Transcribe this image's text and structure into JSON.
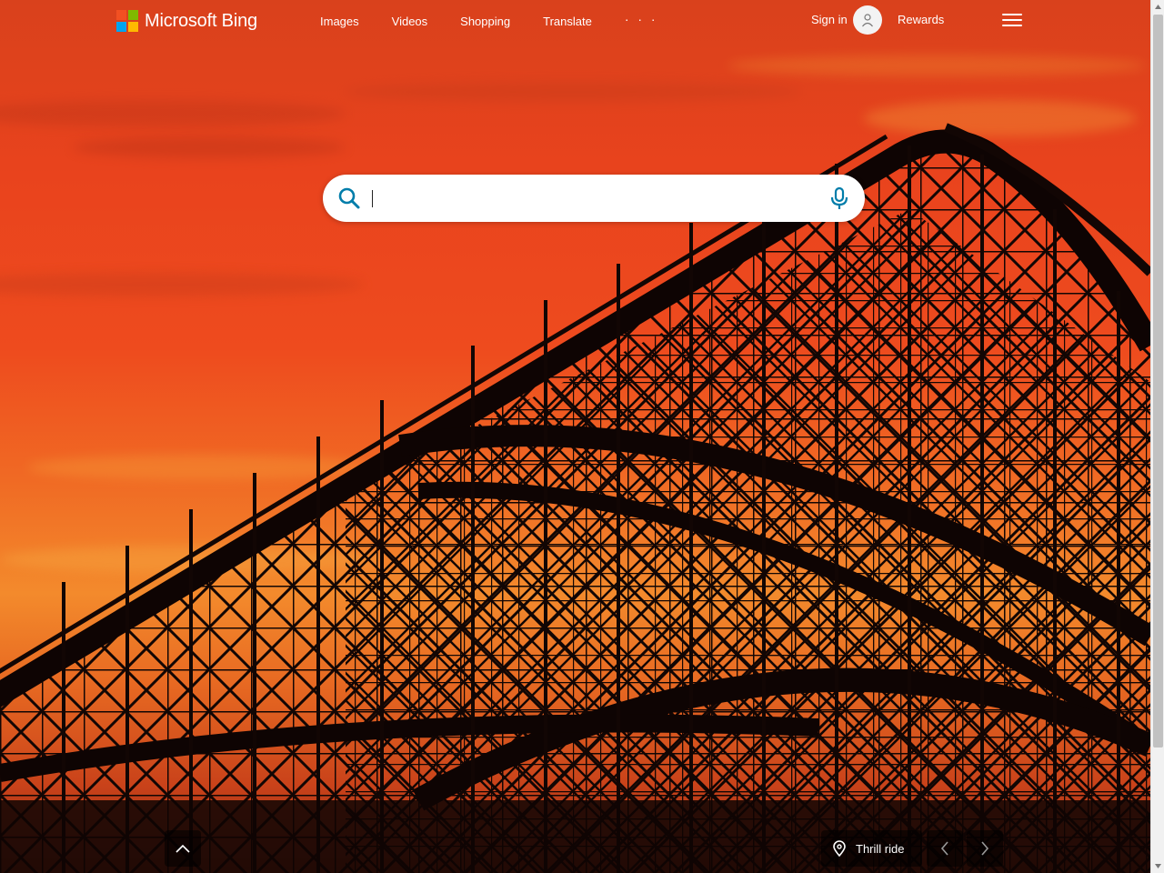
{
  "header": {
    "logo_text": "Microsoft Bing",
    "nav": [
      {
        "label": "Images"
      },
      {
        "label": "Videos"
      },
      {
        "label": "Shopping"
      },
      {
        "label": "Translate"
      }
    ],
    "more_label": "· · ·",
    "signin_label": "Sign in",
    "rewards_label": "Rewards"
  },
  "search": {
    "value": "",
    "placeholder": ""
  },
  "background": {
    "location_label": "Thrill ride"
  },
  "colors": {
    "accent": "#007daa",
    "sky_top": "#d9411c",
    "sky_glow": "#f38a2c"
  }
}
